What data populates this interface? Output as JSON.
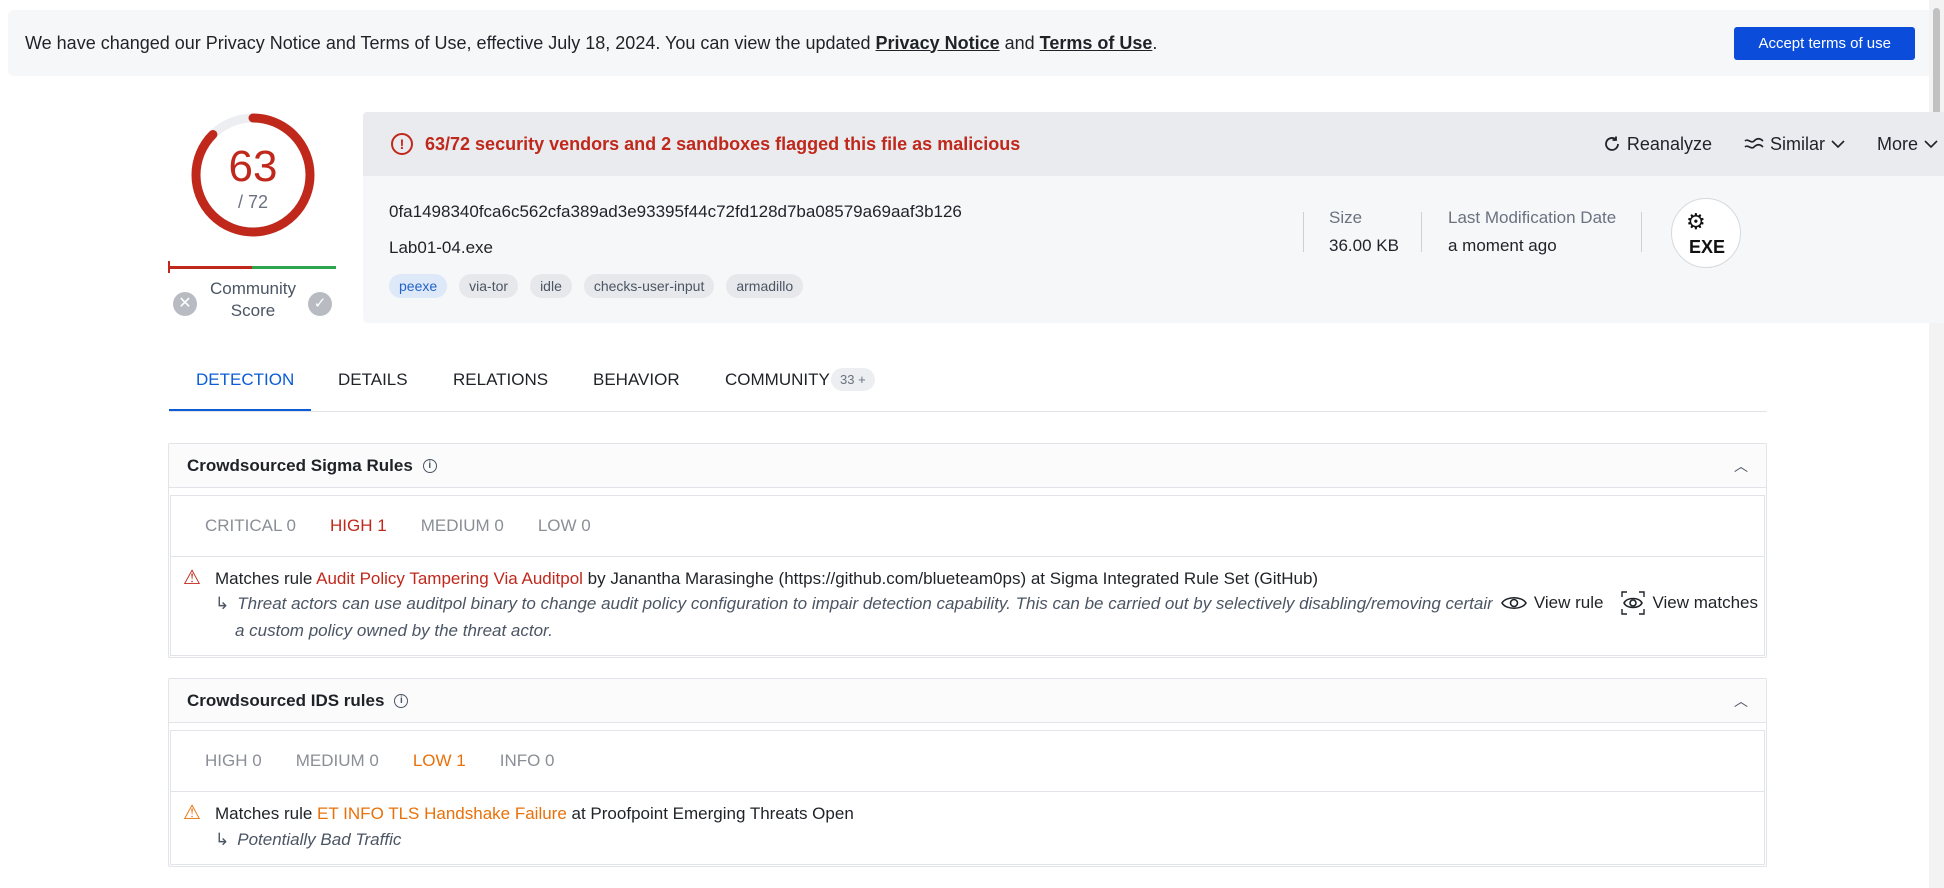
{
  "banner": {
    "text_before": "We have changed our Privacy Notice and Terms of Use, effective July 18, 2024. You can view the updated ",
    "privacy_link": "Privacy Notice",
    "and": " and ",
    "terms_link": "Terms of Use",
    "period": ".",
    "accept_label": "Accept terms of use"
  },
  "score": {
    "value": "63",
    "total": "/ 72",
    "fraction": 0.875,
    "community_label": "Community Score"
  },
  "file": {
    "flag_text": "63/72 security vendors and 2 sandboxes flagged this file as malicious",
    "actions": {
      "reanalyze": "Reanalyze",
      "similar": "Similar",
      "more": "More"
    },
    "hash": "0fa1498340fca6c562cfa389ad3e93395f44c72fd128d7ba08579a69aaf3b126",
    "name": "Lab01-04.exe",
    "tags": [
      "peexe",
      "via-tor",
      "idle",
      "checks-user-input",
      "armadillo"
    ],
    "size_label": "Size",
    "size_value": "36.00 KB",
    "lastmod_label": "Last Modification Date",
    "lastmod_value": "a moment ago",
    "type_badge": "EXE"
  },
  "tabs": [
    {
      "label": "DETECTION"
    },
    {
      "label": "DETAILS"
    },
    {
      "label": "RELATIONS"
    },
    {
      "label": "BEHAVIOR"
    },
    {
      "label": "COMMUNITY"
    }
  ],
  "community_badge": "33 +",
  "sigma": {
    "title": "Crowdsourced Sigma Rules",
    "severities": [
      "CRITICAL 0",
      "HIGH 1",
      "MEDIUM 0",
      "LOW 0"
    ],
    "rule_prefix": "Matches rule ",
    "rule_name": "Audit Policy Tampering Via Auditpol",
    "rule_suffix": " by Janantha Marasinghe (https://github.com/blueteam0ps) at Sigma Integrated Rule Set (GitHub)",
    "desc_line1": "Threat actors can use auditpol binary to change audit policy configuration to impair detection capability. This can be carried out by selectively disabling/removing certain",
    "desc_line2": "a custom policy owned by the threat actor.",
    "view_rule": "View rule",
    "view_matches": "View matches"
  },
  "ids": {
    "title": "Crowdsourced IDS rules",
    "severities": [
      "HIGH 0",
      "MEDIUM 0",
      "LOW 1",
      "INFO 0"
    ],
    "rule_prefix": "Matches rule ",
    "rule_name": "ET INFO TLS Handshake Failure",
    "rule_suffix": " at Proofpoint Emerging Threats Open",
    "desc": "Potentially Bad Traffic"
  },
  "colors": {
    "malicious": "#c0281c",
    "accent": "#0b5cd5",
    "warning": "#e8710a"
  }
}
